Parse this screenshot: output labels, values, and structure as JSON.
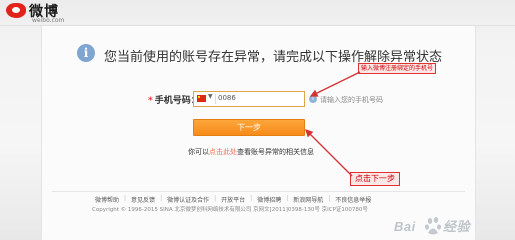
{
  "header": {
    "logo_cn": "微博",
    "logo_en": "weibo.com"
  },
  "main": {
    "info_icon": "i",
    "headline": "您当前使用的账号存在异常，请完成以下操作解除异常状态"
  },
  "form": {
    "required_mark": "*",
    "phone_label": "手机号码：",
    "country_code": "0086",
    "phone_value": "",
    "hint_icon": "i",
    "hint_text": "请输入您的手机号码",
    "next_button": "下一步"
  },
  "question": {
    "prefix": "你可以",
    "link": "点击此处",
    "suffix": "查看账号异常的相关信息"
  },
  "annotations": {
    "phone_callout": "输入微博注册绑定的手机号",
    "next_callout": "点击下一步",
    "color": "#d33333"
  },
  "footer": {
    "links": [
      "微博帮助",
      "意见反馈",
      "微博认证及合作",
      "开放平台",
      "微博招聘",
      "新浪网导航",
      "不良信息举报"
    ],
    "copyright": "Copyright © 1996-2015 SINA 北京微梦创科网络技术有限公司 京网文[2011]0398-130号 京ICP证100780号"
  },
  "watermark": "Baidu经验",
  "colors": {
    "accent": "#f68b1a",
    "link": "#eb7350",
    "logo_red": "#e2231a"
  }
}
